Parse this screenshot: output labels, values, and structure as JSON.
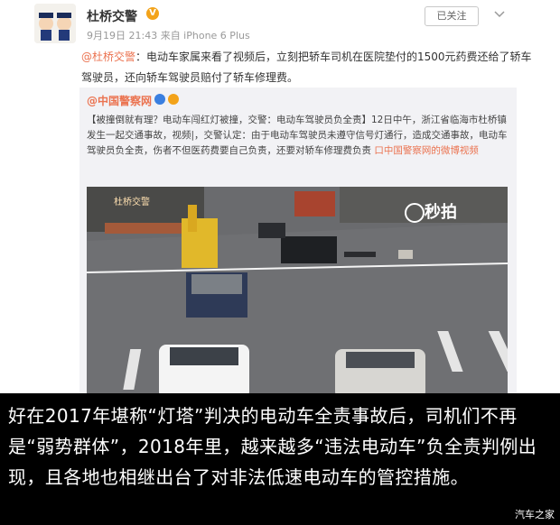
{
  "post": {
    "username": "杜桥交警",
    "verified_glyph": "V",
    "meta": "9月19日 21:43 来自 iPhone 6 Plus",
    "follow_label": "已关注",
    "mention": "@杜桥交警",
    "body": "：电动车家属来看了视频后，立刻把轿车司机在医院垫付的1500元药费还给了轿车驾驶员，还向轿车驾驶员赔付了轿车修理费。",
    "repost": {
      "username": "@中国警察网",
      "text_main": "【被撞倒就有理？电动车闯红灯被撞，交警：电动车驾驶员负全责】12日中午，浙江省临海市杜桥镇发生一起交通事故，视频|，交警认定：由于电动车驾驶员未遵守信号灯通行，造成交通事故，电动车驾驶员负全责，伤者不但医药费要自己负责，还要对轿车修理费负责",
      "link_text": "口中国警察网的微博视频",
      "video_title": "杜桥交警",
      "watermark": "秒拍"
    }
  },
  "caption": {
    "text": "好在2017年堪称“灯塔”判决的电动车全责事故后，司机们不再是“弱势群体”，2018年里，越来越多“违法电动车”负全责判例出现，且各地也相继出台了对非法低速电动车的管控措施。",
    "site": "汽车之家"
  },
  "colors": {
    "accent": "#eb7350",
    "badge": "#f3a31a",
    "caption_bg": "#000000"
  }
}
